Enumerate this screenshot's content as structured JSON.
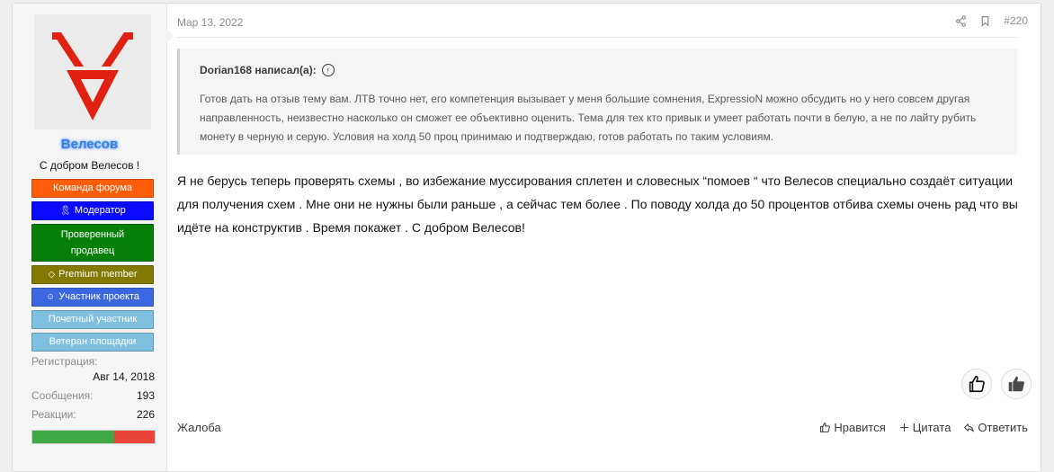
{
  "user": {
    "name": "Велесов",
    "title": "С добром Велесов !",
    "banners": [
      {
        "label": "Команда форума",
        "color": "#ff5d0a",
        "icon": ""
      },
      {
        "label": "Модератор",
        "color": "#0a0aff",
        "icon": "ribbon-icon"
      },
      {
        "label": "Проверенный продавец",
        "color": "#087f08",
        "icon": ""
      },
      {
        "label": "Premium member",
        "color": "#827a00",
        "icon": "diamond-icon"
      },
      {
        "label": "Участник проекта",
        "color": "#3b68e0",
        "icon": "users-icon"
      },
      {
        "label": "Почетный участник",
        "color": "#7fc0e0",
        "icon": ""
      },
      {
        "label": "Ветеран площадки",
        "color": "#7fc0e0",
        "icon": ""
      }
    ],
    "stats": {
      "registration_label": "Регистрация:",
      "registration_value": "Авг 14, 2018",
      "messages_label": "Сообщения:",
      "messages_value": "193",
      "reactions_label": "Реакции:",
      "reactions_value": "226"
    },
    "reputation_positive_fraction": 0.67
  },
  "post": {
    "date": "Map 13, 2022",
    "number": "#220",
    "quote": {
      "author": "Dorian168 написал(а):",
      "text": "Готов дать на отзыв тему вам. ЛТВ точно нет, его компетенция вызывает у меня большие сомнения, ExpressioN можно обсудить но у него совсем другая направленность, неизвестно насколько он сможет ее объективно оценить. Тема для тех кто привык и умеет работать почти в белую, а не по лайту рубить монету в черную и серую. Условия на холд 50 проц принимаю и подтверждаю, готов работать по таким условиям."
    },
    "message": "Я не берусь теперь проверять схемы , во избежание муссирования сплетен и словесных “помоев “ что Велесов специально создаёт ситуации для получения схем . Мне они не нужны были раньше , а сейчас тем более . По поводу холда до 50 процентов отбива схемы очень рад что вы идёте на конструктив . Время покажет . С добром Велесов!"
  },
  "footer": {
    "report": "Жалоба",
    "like": "Нравится",
    "quote": "Цитата",
    "reply": "Ответить"
  },
  "colors": {
    "accent": "#3d7fd6",
    "rep_positive": "#3faa45",
    "rep_negative": "#e9453a"
  }
}
